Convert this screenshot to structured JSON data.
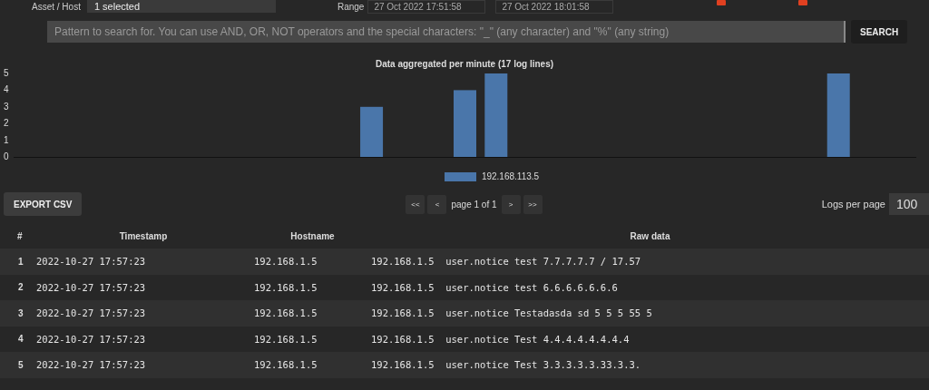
{
  "filters": {
    "asset_label": "Asset / Host",
    "asset_value": "1 selected",
    "range_label": "Range",
    "range_from": "27 Oct 2022 17:51:58",
    "range_to": "27 Oct 2022 18:01:58"
  },
  "search": {
    "placeholder": "Pattern to search for. You can use AND, OR, NOT operators and the special characters: \"_\" (any character) and \"%\" (any string)",
    "button": "SEARCH"
  },
  "chart": {
    "chart_data": {
      "type": "bar",
      "title": "Data aggregated per minute (17 log lines)",
      "ylim": [
        0,
        5
      ],
      "yticks": [
        0,
        1,
        2,
        3,
        4,
        5
      ],
      "series": [
        {
          "name": "192.168.113.5",
          "color": "#4a76aa",
          "values": [
            null,
            null,
            null,
            null,
            null,
            null,
            null,
            null,
            null,
            null,
            null,
            3,
            null,
            null,
            4,
            5,
            null,
            null,
            null,
            null,
            null,
            null,
            null,
            null,
            null,
            null,
            5,
            null,
            null
          ]
        }
      ]
    }
  },
  "toolbar": {
    "export": "EXPORT CSV",
    "pager": [
      "<<",
      "<"
    ],
    "page_text": "page 1 of 1",
    "pager_next": [
      ">",
      ">>"
    ],
    "per_page_label": "Logs per page",
    "per_page_value": "100"
  },
  "table": {
    "columns": [
      "#",
      "Timestamp",
      "Hostname",
      "Raw data"
    ],
    "rows": [
      {
        "n": "1",
        "timestamp": "2022-10-27 17:57:23",
        "hostname": "192.168.1.5",
        "raw": "192.168.1.5  user.notice test 7.7.7.7.7 / 17.57"
      },
      {
        "n": "2",
        "timestamp": "2022-10-27 17:57:23",
        "hostname": "192.168.1.5",
        "raw": "192.168.1.5  user.notice test 6.6.6.6.6.6.6"
      },
      {
        "n": "3",
        "timestamp": "2022-10-27 17:57:23",
        "hostname": "192.168.1.5",
        "raw": "192.168.1.5  user.notice Testadasda sd 5 5 5 55 5"
      },
      {
        "n": "4",
        "timestamp": "2022-10-27 17:57:23",
        "hostname": "192.168.1.5",
        "raw": "192.168.1.5  user.notice Test 4.4.4.4.4.4.4.4"
      },
      {
        "n": "5",
        "timestamp": "2022-10-27 17:57:23",
        "hostname": "192.168.1.5",
        "raw": "192.168.1.5  user.notice Test 3.3.3.3.3.33.3.3."
      }
    ]
  }
}
